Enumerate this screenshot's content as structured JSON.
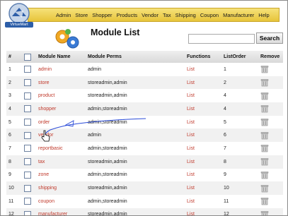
{
  "menu": [
    "Admin",
    "Store",
    "Shopper",
    "Products",
    "Vendor",
    "Tax",
    "Shipping",
    "Coupon",
    "Manufacturer",
    "Help"
  ],
  "logo_text": "VirtueMart",
  "page_title": "Module List",
  "search": {
    "value": "",
    "button": "Search"
  },
  "table": {
    "headers": [
      "#",
      "Module Name",
      "Module Perms",
      "Functions",
      "ListOrder",
      "Remove"
    ],
    "rows": [
      {
        "num": "1",
        "name": "admin",
        "perms": "admin",
        "func": "List",
        "order": "1"
      },
      {
        "num": "2",
        "name": "store",
        "perms": "storeadmin,admin",
        "func": "List",
        "order": "2"
      },
      {
        "num": "3",
        "name": "product",
        "perms": "storeadmin,admin",
        "func": "List",
        "order": "4"
      },
      {
        "num": "4",
        "name": "shopper",
        "perms": "admin,storeadmin",
        "func": "List",
        "order": "4"
      },
      {
        "num": "5",
        "name": "order",
        "perms": "admin,storeadmin",
        "func": "List",
        "order": "5"
      },
      {
        "num": "6",
        "name": "vendor",
        "perms": "admin",
        "func": "List",
        "order": "6"
      },
      {
        "num": "7",
        "name": "reportbasic",
        "perms": "admin,storeadmin",
        "func": "List",
        "order": "7"
      },
      {
        "num": "8",
        "name": "tax",
        "perms": "storeadmin,admin",
        "func": "List",
        "order": "8"
      },
      {
        "num": "9",
        "name": "zone",
        "perms": "admin,storeadmin",
        "func": "List",
        "order": "9"
      },
      {
        "num": "10",
        "name": "shipping",
        "perms": "storeadmin,admin",
        "func": "List",
        "order": "10"
      },
      {
        "num": "11",
        "name": "coupon",
        "perms": "admin,storeadmin",
        "func": "List",
        "order": "11"
      },
      {
        "num": "12",
        "name": "manufacturer",
        "perms": "storeadmin,admin",
        "func": "List",
        "order": "12"
      }
    ]
  },
  "colors": {
    "menu_bar": "#e7c43a",
    "link": "#c0392b",
    "annotation": "#2a4bd8"
  },
  "icons": {
    "remove": "trash-icon",
    "logo": "virtuemart-logo",
    "header": "gears-icon"
  }
}
